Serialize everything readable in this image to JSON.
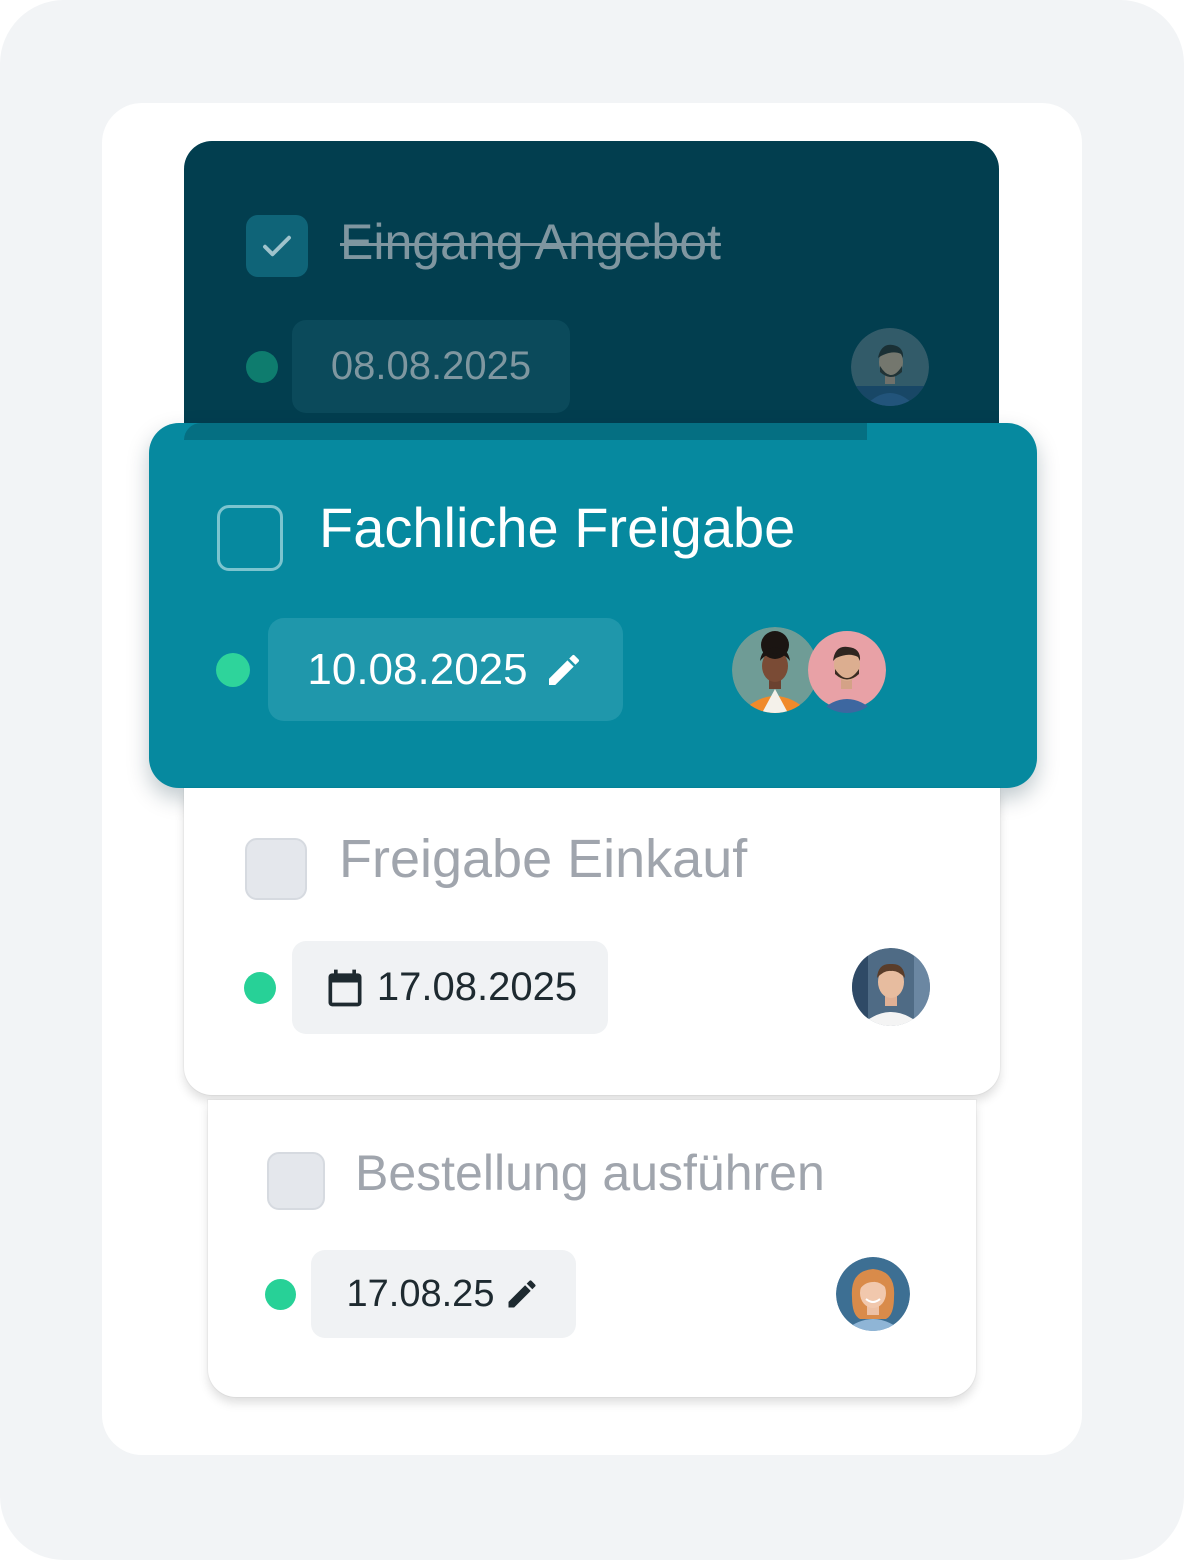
{
  "tasks": [
    {
      "title": "Eingang Angebot",
      "status": "done",
      "date": "08.08.2025",
      "date_icon": "none",
      "assignees": [
        "man-bearded-avatar"
      ]
    },
    {
      "title": "Fachliche Freigabe",
      "status": "active",
      "date": "10.08.2025",
      "date_icon": "pencil-icon",
      "assignees": [
        "woman-orange-jacket-avatar",
        "man-bearded-avatar"
      ]
    },
    {
      "title": "Freigabe Einkauf",
      "status": "pending",
      "date": "17.08.2025",
      "date_icon": "calendar-icon",
      "assignees": [
        "man-white-shirt-avatar"
      ]
    },
    {
      "title": "Bestellung ausführen",
      "status": "pending",
      "date": "17.08.25",
      "date_icon": "pencil-icon",
      "assignees": [
        "woman-blonde-avatar"
      ]
    }
  ],
  "colors": {
    "background": "#f2f4f6",
    "done_card": "#023e4f",
    "active_card": "#06899f",
    "status_dot": "#27d197",
    "checkbox_done": "#0f6478"
  }
}
